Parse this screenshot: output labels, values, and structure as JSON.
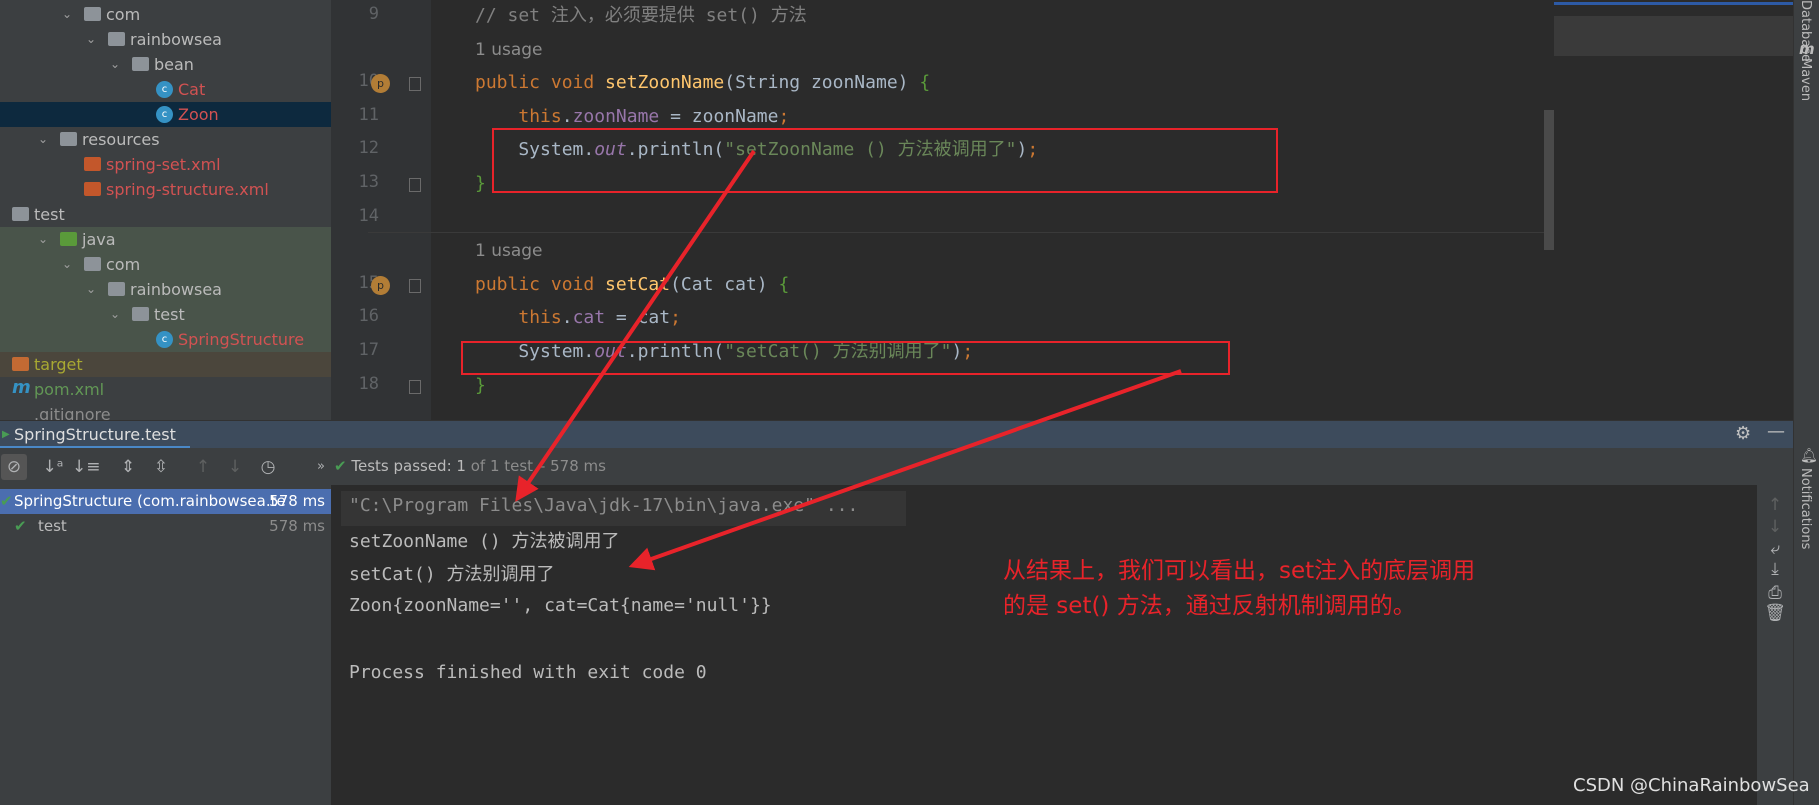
{
  "project_tree": [
    {
      "label": "com",
      "indent": 3,
      "icon": "folder-icon",
      "color": "#bbbbbb"
    },
    {
      "label": "rainbowsea",
      "indent": 4,
      "icon": "folder-icon",
      "color": "#bbbbbb"
    },
    {
      "label": "bean",
      "indent": 5,
      "icon": "folder-icon",
      "color": "#bbbbbb"
    },
    {
      "label": "Cat",
      "indent": 6,
      "icon": "class-icon",
      "color": "#d25252",
      "leaf": true
    },
    {
      "label": "Zoon",
      "indent": 6,
      "icon": "class-icon",
      "color": "#d25252",
      "leaf": true,
      "selected": true
    },
    {
      "label": "resources",
      "indent": 2,
      "icon": "folder-icon",
      "color": "#bbbbbb"
    },
    {
      "label": "spring-set.xml",
      "indent": 3,
      "icon": "xml-icon",
      "color": "#d25252",
      "leaf": true
    },
    {
      "label": "spring-structure.xml",
      "indent": 3,
      "icon": "xml-icon",
      "color": "#d25252",
      "leaf": true
    },
    {
      "label": "test",
      "indent": 0,
      "icon": "folder-icon",
      "color": "#bbbbbb"
    },
    {
      "label": "java",
      "indent": 2,
      "icon": "folder-icon",
      "color": "#bbbbbb",
      "green": true
    },
    {
      "label": "com",
      "indent": 3,
      "icon": "folder-icon",
      "color": "#bbbbbb",
      "green": true
    },
    {
      "label": "rainbowsea",
      "indent": 4,
      "icon": "folder-icon",
      "color": "#bbbbbb",
      "green": true
    },
    {
      "label": "test",
      "indent": 5,
      "icon": "folder-icon",
      "color": "#bbbbbb",
      "green": true
    },
    {
      "label": "SpringStructure",
      "indent": 6,
      "icon": "test-class-icon",
      "color": "#d25252",
      "leaf": true,
      "green": true
    },
    {
      "label": "target",
      "indent": 0,
      "icon": "folder-icon",
      "color": "#a8a832",
      "leaf": true,
      "target": true
    },
    {
      "label": "pom.xml",
      "indent": 0,
      "icon": "maven-icon",
      "color": "#629755",
      "leaf": true
    },
    {
      "label": ".gitignore",
      "indent": 0,
      "icon": "file-icon",
      "color": "#8c8c8c",
      "leaf": true
    }
  ],
  "editor": {
    "lines": [
      {
        "num": "9",
        "html": "<span class='cm'>// set 注入，必须要提供 set() 方法</span>"
      },
      {
        "num": "",
        "html": "<span class='usage'>1 usage</span>"
      },
      {
        "num": "10",
        "badge": true,
        "fold": true,
        "html": "<span class='kw'>public void </span><span class='fn'>setZoonName</span>(String zoonName) <span class='br'>{</span>"
      },
      {
        "num": "11",
        "html": "    <span class='kw'>this</span>.<span class='fld'>zoonName</span> = zoonName<span class='kw'>;</span>"
      },
      {
        "num": "12",
        "html": "    System.<span class='fld it'>out</span>.println(<span class='str'>\"setZoonName () 方法被调用了\"</span>)<span class='kw'>;</span>"
      },
      {
        "num": "13",
        "fold": true,
        "html": "<span class='br'>}</span>"
      },
      {
        "num": "14",
        "html": ""
      },
      {
        "num": "",
        "html": "<span class='usage'>1 usage</span>"
      },
      {
        "num": "15",
        "badge": true,
        "fold": true,
        "html": "<span class='kw'>public void </span><span class='fn'>setCat</span>(Cat cat) <span class='br'>{</span>"
      },
      {
        "num": "16",
        "html": "    <span class='kw'>this</span>.<span class='fld'>cat</span> = cat<span class='kw'>;</span>"
      },
      {
        "num": "17",
        "html": "    System.<span class='fld it'>out</span>.println(<span class='str'>\"setCat() 方法别调用了\"</span>)<span class='kw'>;</span>"
      },
      {
        "num": "18",
        "fold": true,
        "html": "<span class='br'>}</span>"
      }
    ]
  },
  "right_strip": {
    "database": "Database",
    "maven": "Maven",
    "notifications": "Notifications"
  },
  "run_panel": {
    "tab_label": "SpringStructure.test",
    "status_prefix": "Tests passed: ",
    "status_count": "1",
    "status_suffix": " of 1 test – 578 ms",
    "tests": [
      {
        "label": "SpringStructure (com.rainbowsea.te",
        "time": "578 ms",
        "selected": true
      },
      {
        "label": "test",
        "time": "578 ms"
      }
    ],
    "console": [
      "\"C:\\Program Files\\Java\\jdk-17\\bin\\java.exe\" ...",
      "setZoonName () 方法被调用了",
      "setCat() 方法别调用了",
      "Zoon{zoonName='', cat=Cat{name='null'}}",
      "",
      "Process finished with exit code 0"
    ]
  },
  "annotation": {
    "line1": "从结果上，我们可以看出，set注入的底层调用",
    "line2": "的是 set() 方法，通过反射机制调用的。",
    "color": "#e8232a"
  },
  "watermark": "CSDN @ChinaRainbowSea"
}
